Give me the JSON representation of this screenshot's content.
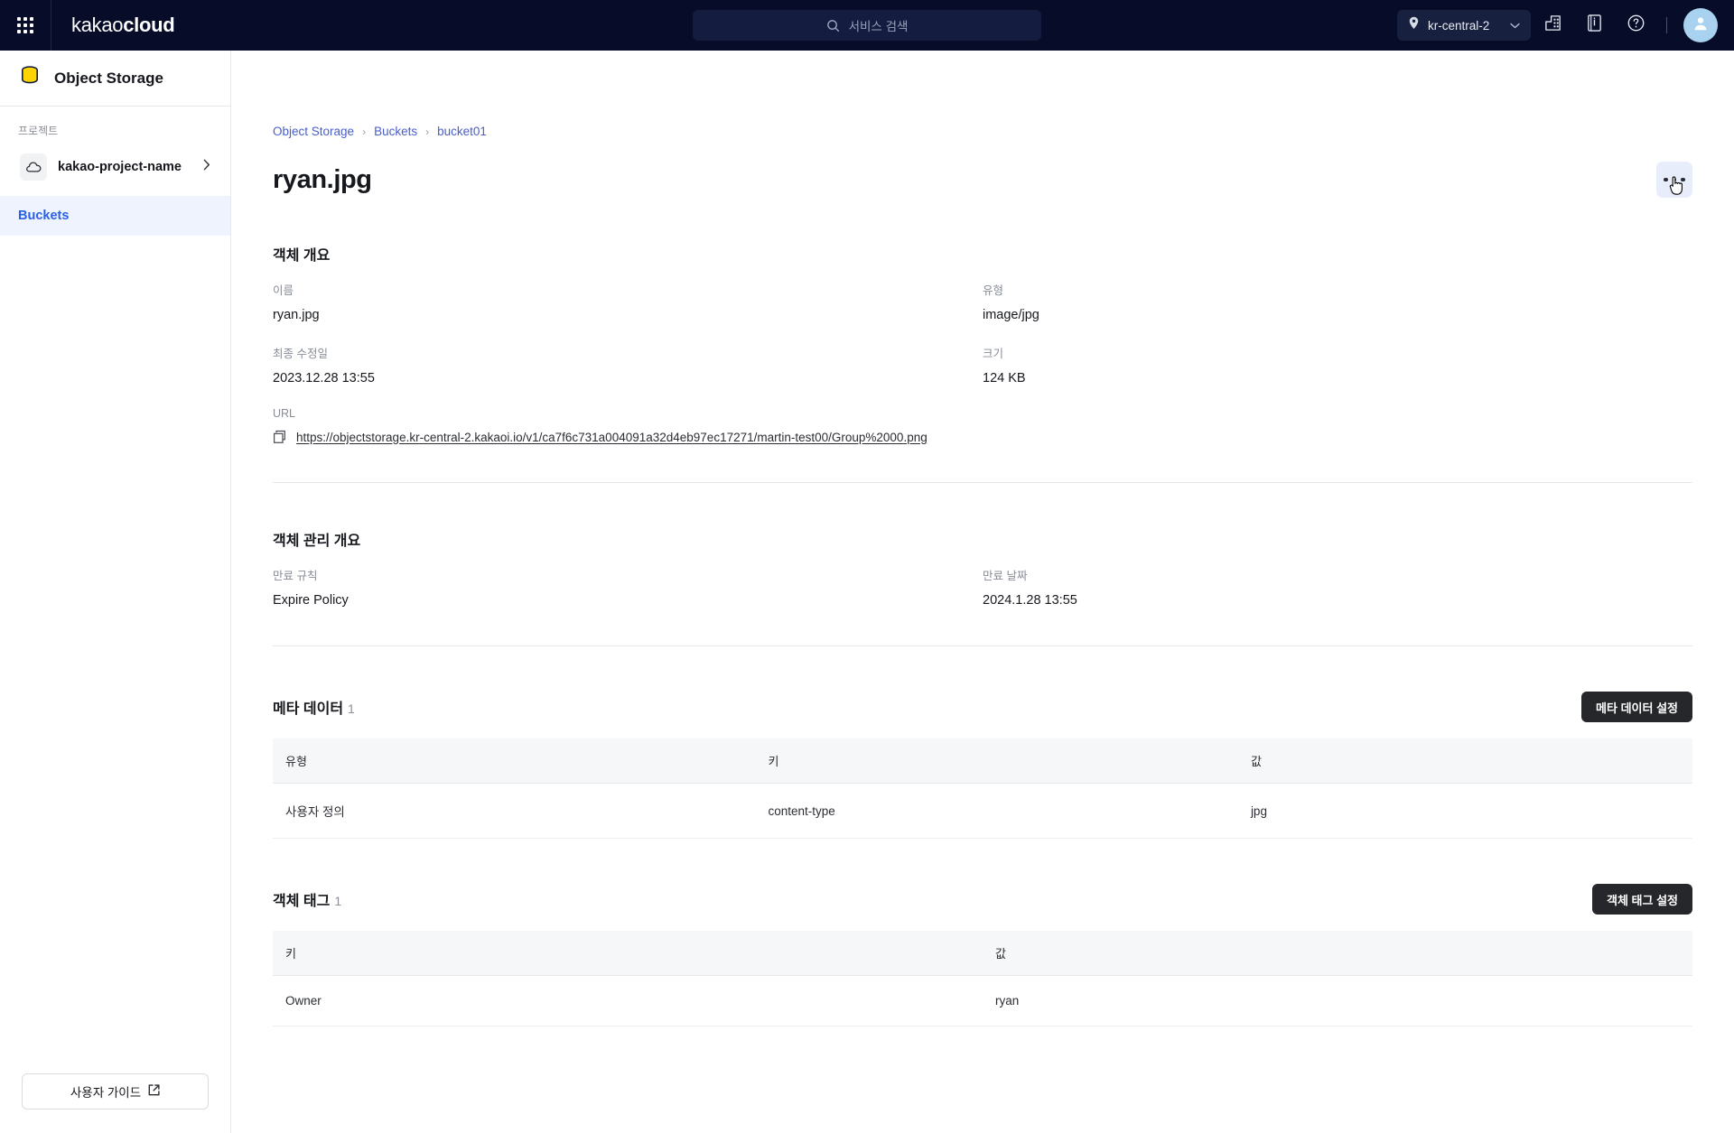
{
  "topbar": {
    "apps_icon": "grid-apps-icon",
    "brand_light": "kakao",
    "brand_bold": "cloud",
    "search_placeholder": "서비스 검색",
    "search_icon": "search-icon",
    "region": "kr-central-2",
    "region_icon": "location-pin-icon",
    "region_chevron": "chevron-down-icon",
    "org_icon": "organization-icon",
    "docs_icon": "document-info-icon",
    "help_icon": "help-circle-icon",
    "avatar_icon": "user-avatar-icon"
  },
  "sidebar": {
    "service_name": "Object Storage",
    "service_icon": "object-storage-database-icon",
    "project_label": "프로젝트",
    "project_name": "kakao-project-name",
    "project_icon": "cloud-icon",
    "project_arrow_icon": "chevron-right-icon",
    "nav": [
      {
        "label": "Buckets",
        "active": true
      }
    ],
    "guide_label": "사용자 가이드",
    "guide_icon": "external-link-icon"
  },
  "breadcrumb": [
    {
      "label": "Object Storage"
    },
    {
      "label": "Buckets"
    },
    {
      "label": "bucket01"
    }
  ],
  "page": {
    "title": "ryan.jpg",
    "kebab_icon": "more-options-icon"
  },
  "overview": {
    "title": "객체 개요",
    "fields": [
      {
        "label": "이름",
        "value": "ryan.jpg"
      },
      {
        "label": "유형",
        "value": "image/jpg"
      },
      {
        "label": "최종 수정일",
        "value": "2023.12.28 13:55"
      },
      {
        "label": "크기",
        "value": "124 KB"
      }
    ],
    "url_label": "URL",
    "url_value": "https://objectstorage.kr-central-2.kakaoi.io/v1/ca7f6c731a004091a32d4eb97ec17271/martin-test00/Group%2000.png",
    "copy_icon": "copy-icon"
  },
  "management": {
    "title": "객체 관리 개요",
    "fields": [
      {
        "label": "만료 규칙",
        "value": "Expire Policy"
      },
      {
        "label": "만료 날짜",
        "value": "2024.1.28 13:55"
      }
    ]
  },
  "metadata": {
    "title": "메타 데이터",
    "count": "1",
    "button": "메타 데이터 설정",
    "columns": [
      "유형",
      "키",
      "값"
    ],
    "rows": [
      {
        "type": "사용자 정의",
        "key": "content-type",
        "value": "jpg"
      }
    ]
  },
  "tags": {
    "title": "객체 태그",
    "count": "1",
    "button": "객체 태그 설정",
    "columns": [
      "키",
      "값"
    ],
    "rows": [
      {
        "key": "Owner",
        "value": "ryan"
      }
    ]
  },
  "colors": {
    "topbar_bg": "#070d28",
    "accent_blue": "#2a60e8",
    "link_blue": "#4a5ec8",
    "nav_active_bg": "#eef3fe",
    "dark_button": "#26272b",
    "avatar_bg": "#a8d2f0"
  }
}
